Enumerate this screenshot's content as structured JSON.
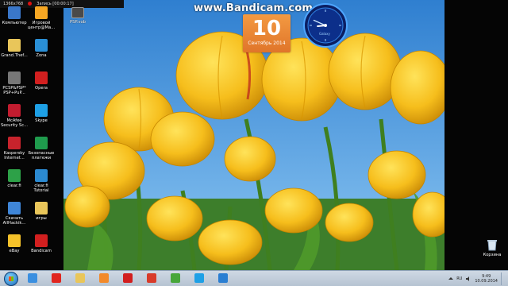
{
  "recording_bar": {
    "resolution": "1366x768",
    "status": "Запись [00:00:17]"
  },
  "watermark": "www.Bandicam.com",
  "desktop_icons": [
    {
      "label": "Компьютер",
      "icon": "computer-icon",
      "color": "#3a77c9"
    },
    {
      "label": "Игровой\nцентр@Ма...",
      "icon": "game-center-icon",
      "color": "#f5a623"
    },
    {
      "label": "Grand.Thef...",
      "icon": "folder-icon",
      "color": "#e9c65a"
    },
    {
      "label": "Zona",
      "icon": "zona-icon",
      "color": "#2a8fd6"
    },
    {
      "label": "PCSP&PSP*\nPSP+PuP...",
      "icon": "psp-icon",
      "color": "#777777"
    },
    {
      "label": "Opera",
      "icon": "opera-icon",
      "color": "#d21f1f"
    },
    {
      "label": "McAfee\nSecurity Sc...",
      "icon": "mcafee-icon",
      "color": "#c21c2f"
    },
    {
      "label": "Skype",
      "icon": "skype-icon",
      "color": "#1ea0e6"
    },
    {
      "label": "Kaspersky\nInternet...",
      "icon": "kaspersky-icon",
      "color": "#c8232c"
    },
    {
      "label": "Безопасные\nплатежи",
      "icon": "safe-money-icon",
      "color": "#1f9b4d"
    },
    {
      "label": "clear.fi",
      "icon": "clearfi-icon",
      "color": "#2da148"
    },
    {
      "label": "clear.fi\nTutorial",
      "icon": "clearfi-tutorial-icon",
      "color": "#2b8ad1"
    },
    {
      "label": "Скачать\nAllHackik...",
      "icon": "download-icon",
      "color": "#3f86d8"
    },
    {
      "label": "игры",
      "icon": "games-folder-icon",
      "color": "#e9c65a"
    },
    {
      "label": "eBay",
      "icon": "ebay-icon",
      "color": "#f4c12a"
    },
    {
      "label": "Bandicam",
      "icon": "bandicam-icon",
      "color": "#d21f1f"
    }
  ],
  "top_icon": {
    "label": "PSP.vob",
    "icon": "video-file-icon"
  },
  "calendar": {
    "day": "10",
    "month": "Сентябрь 2014",
    "color": "#f08a38"
  },
  "clock_widget": {
    "label": "Galaxy",
    "icon": "clock-icon",
    "hour": 8,
    "minute": 49
  },
  "recycle_bin": {
    "label": "Корзина",
    "icon": "recycle-bin-icon"
  },
  "taskbar": {
    "items": [
      {
        "icon": "start-orb-icon",
        "color": "#1a69b8"
      },
      {
        "icon": "internet-explorer-icon",
        "color": "#3a8fe0"
      },
      {
        "icon": "yandex-icon",
        "color": "#e0261f"
      },
      {
        "icon": "explorer-folder-icon",
        "color": "#e9c65a"
      },
      {
        "icon": "media-player-icon",
        "color": "#f28a2b"
      },
      {
        "icon": "opera-taskbar-icon",
        "color": "#d21f1f"
      },
      {
        "icon": "yandex-browser-icon",
        "color": "#d83b2a"
      },
      {
        "icon": "utorrent-icon",
        "color": "#47a63a"
      },
      {
        "icon": "skype-taskbar-icon",
        "color": "#1ea0e6"
      },
      {
        "icon": "windows-update-icon",
        "color": "#2a7ed2"
      }
    ],
    "tray": {
      "lang": "RU",
      "time": "9:49",
      "date": "10.09.2014"
    }
  }
}
